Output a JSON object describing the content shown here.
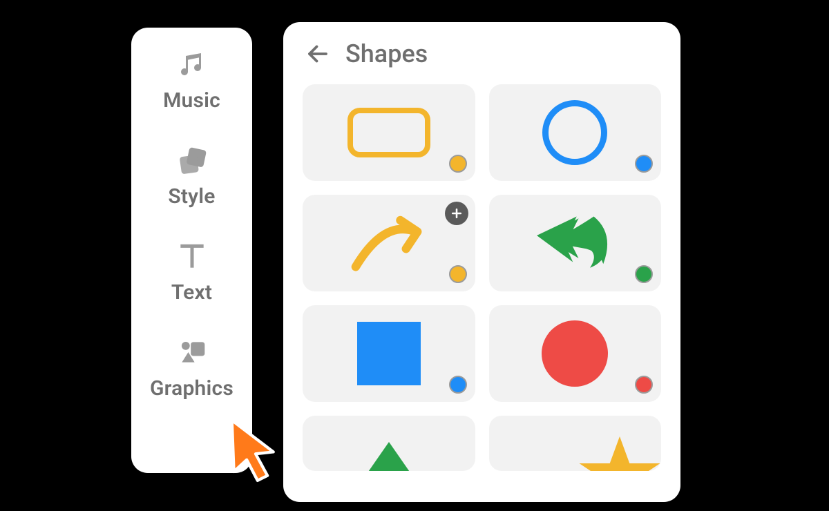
{
  "sidebar": {
    "items": [
      {
        "label": "Music",
        "icon": "music-icon"
      },
      {
        "label": "Style",
        "icon": "style-icon"
      },
      {
        "label": "Text",
        "icon": "text-icon"
      },
      {
        "label": "Graphics",
        "icon": "graphics-icon"
      }
    ]
  },
  "panel": {
    "title": "Shapes",
    "shapes": [
      {
        "name": "rounded-rectangle",
        "color": "#f3b52c",
        "has_add": false
      },
      {
        "name": "circle-outline",
        "color": "#1f8df7",
        "has_add": false
      },
      {
        "name": "arrow-right",
        "color": "#f3b52c",
        "has_add": true
      },
      {
        "name": "arrow-left-fill",
        "color": "#2aa24a",
        "has_add": false
      },
      {
        "name": "square",
        "color": "#1f8df7",
        "has_add": false
      },
      {
        "name": "circle",
        "color": "#ee4b46",
        "has_add": false
      },
      {
        "name": "triangle",
        "color": "#2aa24a",
        "has_add": false
      },
      {
        "name": "star",
        "color": "#f3b52c",
        "has_add": false
      }
    ]
  },
  "colors": {
    "icon_gray": "#9b9b9b",
    "text_gray": "#6f6f6f",
    "tile_bg": "#f2f2f2",
    "cursor_orange": "#ff7a1a"
  }
}
